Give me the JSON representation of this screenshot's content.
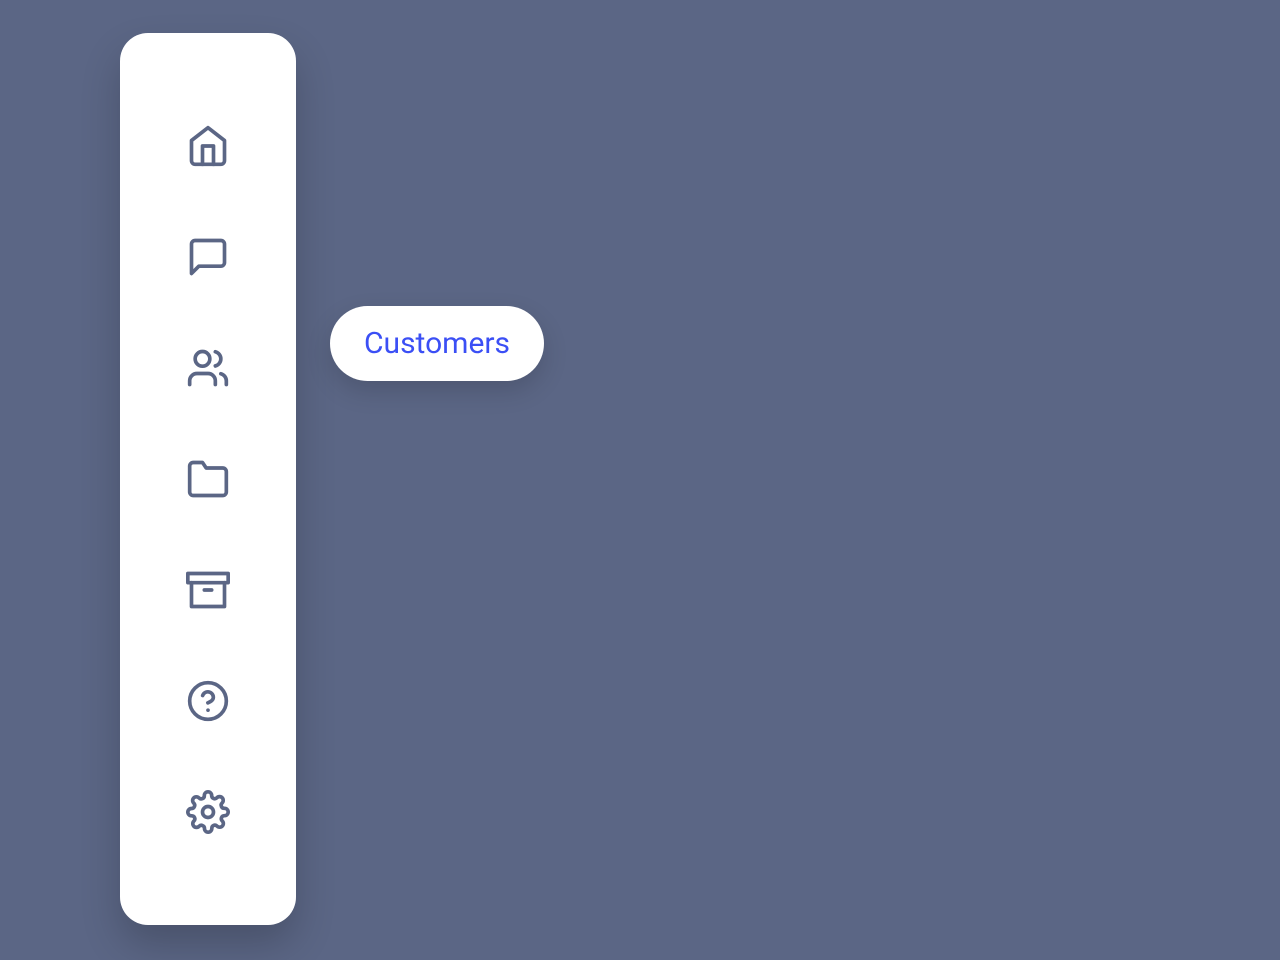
{
  "sidebar": {
    "items": [
      {
        "id": "home",
        "tooltip": "Home"
      },
      {
        "id": "messages",
        "tooltip": "Messages"
      },
      {
        "id": "customers",
        "tooltip": "Customers"
      },
      {
        "id": "projects",
        "tooltip": "Projects"
      },
      {
        "id": "archive",
        "tooltip": "Archive"
      },
      {
        "id": "help",
        "tooltip": "Help"
      },
      {
        "id": "settings",
        "tooltip": "Settings"
      }
    ],
    "active_index": 2
  },
  "tooltip": {
    "visible": true,
    "text": "Customers"
  },
  "colors": {
    "background": "#5b6685",
    "sidebar_bg": "#ffffff",
    "icon": "#5b6685",
    "tooltip_text": "#3b4ff5"
  }
}
